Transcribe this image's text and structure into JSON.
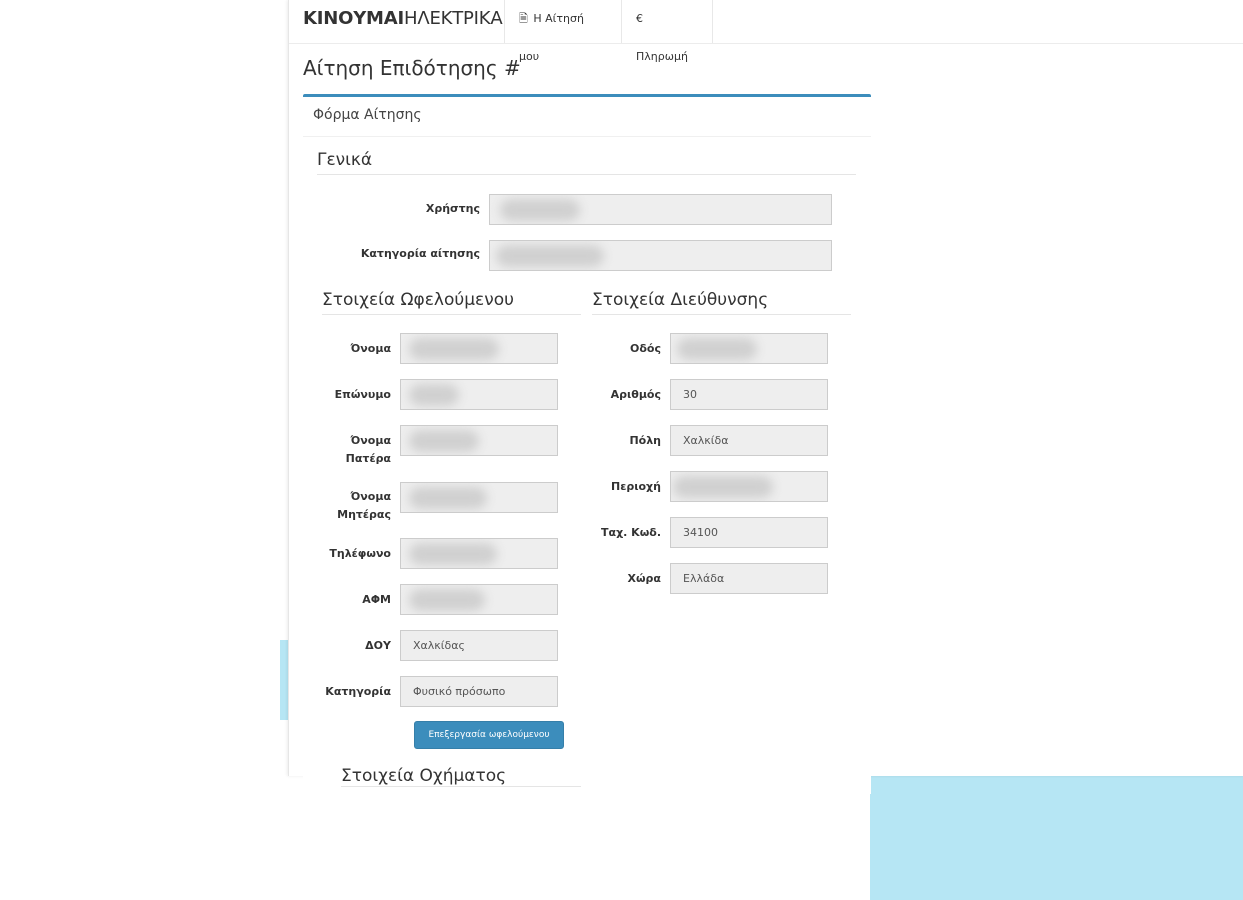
{
  "navbar": {
    "brand_bold": "ΚΙΝΟΥΜΑΙ",
    "brand_rest": "ΗΛΕΚΤΡΙΚΑ",
    "items": [
      {
        "icon": "file-text-icon",
        "glyph": "🗎",
        "label": "Η Αίτησή μου"
      },
      {
        "icon": "euro-icon",
        "glyph": "€",
        "label": "Πληρωμή"
      }
    ]
  },
  "page": {
    "title": "Αίτηση Επιδότησης #"
  },
  "panel": {
    "heading": "Φόρμα Αίτησης"
  },
  "general": {
    "legend": "Γενικά",
    "fields": [
      {
        "label": "Χρήστης",
        "value": ""
      },
      {
        "label": "Κατηγορία αίτησης",
        "value": ""
      }
    ]
  },
  "beneficiary": {
    "legend": "Στοιχεία Ωφελούμενου",
    "fields": [
      {
        "label": "Όνομα",
        "value": ""
      },
      {
        "label": "Επώνυμο",
        "value": ""
      },
      {
        "label": "Όνομα Πατέρα",
        "value": ""
      },
      {
        "label": "Όνομα Μητέρας",
        "value": ""
      },
      {
        "label": "Τηλέφωνο",
        "value": ""
      },
      {
        "label": "ΑΦΜ",
        "value": ""
      },
      {
        "label": "ΔΟΥ",
        "value": "Χαλκίδας"
      },
      {
        "label": "Κατηγορία",
        "value": "Φυσικό πρόσωπο"
      }
    ],
    "edit_button": "Επεξεργασία ωφελούμενου"
  },
  "address": {
    "legend": "Στοιχεία Διεύθυνσης",
    "fields": [
      {
        "label": "Οδός",
        "value": ""
      },
      {
        "label": "Αριθμός",
        "value": "30"
      },
      {
        "label": "Πόλη",
        "value": "Χαλκίδα"
      },
      {
        "label": "Περιοχή",
        "value": ""
      },
      {
        "label": "Ταχ. Κωδ.",
        "value": "34100"
      },
      {
        "label": "Χώρα",
        "value": "Ελλάδα"
      }
    ]
  },
  "next_section": {
    "legend": "Στοιχεία Οχήματος"
  },
  "colors": {
    "accent": "#3c8dbc",
    "field_bg": "#eeeeee",
    "wave": "#b6e6f4"
  }
}
